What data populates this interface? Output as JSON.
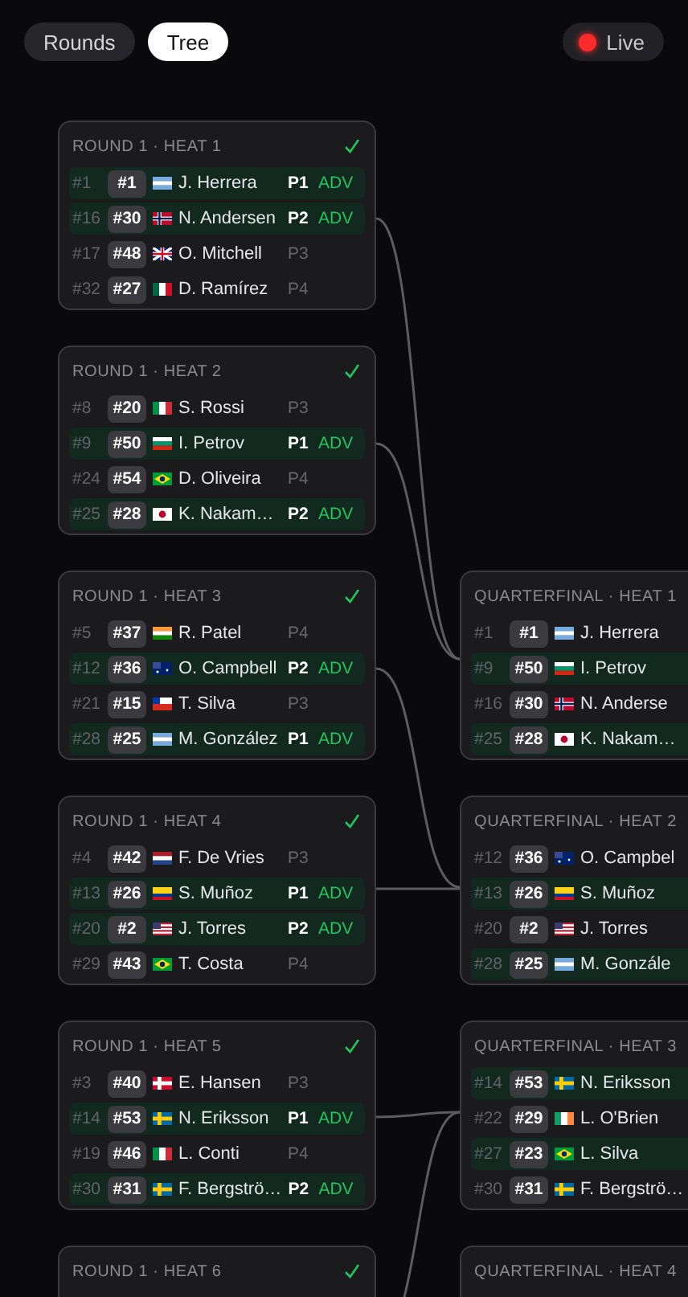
{
  "view_tabs": [
    {
      "label": "Rounds",
      "selected": false
    },
    {
      "label": "Tree",
      "selected": true
    }
  ],
  "live": {
    "label": "Live",
    "on": true
  },
  "rounds": [
    {
      "heats": [
        {
          "title": "ROUND 1 · HEAT 1",
          "done": true,
          "rows": [
            {
              "seed": "#1",
              "bib": "#1",
              "flag": {
                "kind": "ar"
              },
              "name": "J. Herrera",
              "place": "P1",
              "adv": "ADV",
              "highlighted": true
            },
            {
              "seed": "#16",
              "bib": "#30",
              "flag": {
                "kind": "no"
              },
              "name": "N. Andersen",
              "place": "P2",
              "adv": "ADV",
              "highlighted": true
            },
            {
              "seed": "#17",
              "bib": "#48",
              "flag": {
                "kind": "gb"
              },
              "name": "O. Mitchell",
              "place": "P3",
              "highlighted": false
            },
            {
              "seed": "#32",
              "bib": "#27",
              "flag": {
                "kind": "mx"
              },
              "name": "D. Ramírez",
              "place": "P4",
              "highlighted": false
            }
          ]
        },
        {
          "title": "ROUND 1 · HEAT 2",
          "done": true,
          "rows": [
            {
              "seed": "#8",
              "bib": "#20",
              "flag": {
                "kind": "it"
              },
              "name": "S. Rossi",
              "place": "P3",
              "highlighted": false
            },
            {
              "seed": "#9",
              "bib": "#50",
              "flag": {
                "kind": "bg"
              },
              "name": "I. Petrov",
              "place": "P1",
              "adv": "ADV",
              "highlighted": true
            },
            {
              "seed": "#24",
              "bib": "#54",
              "flag": {
                "kind": "br"
              },
              "name": "D. Oliveira",
              "place": "P4",
              "highlighted": false
            },
            {
              "seed": "#25",
              "bib": "#28",
              "flag": {
                "kind": "jp"
              },
              "name": "K. Nakam…",
              "place": "P2",
              "adv": "ADV",
              "highlighted": true
            }
          ]
        },
        {
          "title": "ROUND 1 · HEAT 3",
          "done": true,
          "rows": [
            {
              "seed": "#5",
              "bib": "#37",
              "flag": {
                "kind": "in"
              },
              "name": "R. Patel",
              "place": "P4",
              "highlighted": false
            },
            {
              "seed": "#12",
              "bib": "#36",
              "flag": {
                "kind": "au"
              },
              "name": "O. Campbell",
              "place": "P2",
              "adv": "ADV",
              "highlighted": true
            },
            {
              "seed": "#21",
              "bib": "#15",
              "flag": {
                "kind": "cl"
              },
              "name": "T. Silva",
              "place": "P3",
              "highlighted": false
            },
            {
              "seed": "#28",
              "bib": "#25",
              "flag": {
                "kind": "ar"
              },
              "name": "M. González",
              "place": "P1",
              "adv": "ADV",
              "highlighted": true
            }
          ]
        },
        {
          "title": "ROUND 1 · HEAT 4",
          "done": true,
          "rows": [
            {
              "seed": "#4",
              "bib": "#42",
              "flag": {
                "kind": "nl"
              },
              "name": "F. De Vries",
              "place": "P3",
              "highlighted": false
            },
            {
              "seed": "#13",
              "bib": "#26",
              "flag": {
                "kind": "co"
              },
              "name": "S. Muñoz",
              "place": "P1",
              "adv": "ADV",
              "highlighted": true
            },
            {
              "seed": "#20",
              "bib": "#2",
              "flag": {
                "kind": "us"
              },
              "name": "J. Torres",
              "place": "P2",
              "adv": "ADV",
              "highlighted": true
            },
            {
              "seed": "#29",
              "bib": "#43",
              "flag": {
                "kind": "br"
              },
              "name": "T. Costa",
              "place": "P4",
              "highlighted": false
            }
          ]
        },
        {
          "title": "ROUND 1 · HEAT 5",
          "done": true,
          "rows": [
            {
              "seed": "#3",
              "bib": "#40",
              "flag": {
                "kind": "dk"
              },
              "name": "E. Hansen",
              "place": "P3",
              "highlighted": false
            },
            {
              "seed": "#14",
              "bib": "#53",
              "flag": {
                "kind": "se"
              },
              "name": "N. Eriksson",
              "place": "P1",
              "adv": "ADV",
              "highlighted": true
            },
            {
              "seed": "#19",
              "bib": "#46",
              "flag": {
                "kind": "it"
              },
              "name": "L. Conti",
              "place": "P4",
              "highlighted": false
            },
            {
              "seed": "#30",
              "bib": "#31",
              "flag": {
                "kind": "se"
              },
              "name": "F. Bergströ…",
              "place": "P2",
              "adv": "ADV",
              "highlighted": true
            }
          ]
        },
        {
          "title": "ROUND 1 · HEAT 6",
          "done": true
        }
      ]
    },
    {
      "heats": [
        {
          "title": "QUARTERFINAL · HEAT 1",
          "rows": [
            {
              "seed": "#1",
              "bib": "#1",
              "flag": {
                "kind": "ar"
              },
              "name": "J. Herrera",
              "highlighted": false
            },
            {
              "seed": "#9",
              "bib": "#50",
              "flag": {
                "kind": "bg"
              },
              "name": "I. Petrov",
              "highlighted": true
            },
            {
              "seed": "#16",
              "bib": "#30",
              "flag": {
                "kind": "no"
              },
              "name": "N. Anderse",
              "highlighted": false
            },
            {
              "seed": "#25",
              "bib": "#28",
              "flag": {
                "kind": "jp"
              },
              "name": "K. Nakam…",
              "highlighted": true
            }
          ]
        },
        {
          "title": "QUARTERFINAL · HEAT 2",
          "rows": [
            {
              "seed": "#12",
              "bib": "#36",
              "flag": {
                "kind": "au"
              },
              "name": "O. Campbel",
              "highlighted": false
            },
            {
              "seed": "#13",
              "bib": "#26",
              "flag": {
                "kind": "co"
              },
              "name": "S. Muñoz",
              "highlighted": true
            },
            {
              "seed": "#20",
              "bib": "#2",
              "flag": {
                "kind": "us"
              },
              "name": "J. Torres",
              "highlighted": false
            },
            {
              "seed": "#28",
              "bib": "#25",
              "flag": {
                "kind": "ar"
              },
              "name": "M. Gonzále",
              "highlighted": true
            }
          ]
        },
        {
          "title": "QUARTERFINAL · HEAT 3",
          "rows": [
            {
              "seed": "#14",
              "bib": "#53",
              "flag": {
                "kind": "se"
              },
              "name": "N. Eriksson",
              "highlighted": true
            },
            {
              "seed": "#22",
              "bib": "#29",
              "flag": {
                "kind": "ie"
              },
              "name": "L. O'Brien",
              "highlighted": false
            },
            {
              "seed": "#27",
              "bib": "#23",
              "flag": {
                "kind": "br"
              },
              "name": "L. Silva",
              "highlighted": true
            },
            {
              "seed": "#30",
              "bib": "#31",
              "flag": {
                "kind": "se"
              },
              "name": "F. Bergströ…",
              "highlighted": false
            }
          ]
        },
        {
          "title": "QUARTERFINAL · HEAT 4"
        }
      ]
    }
  ]
}
